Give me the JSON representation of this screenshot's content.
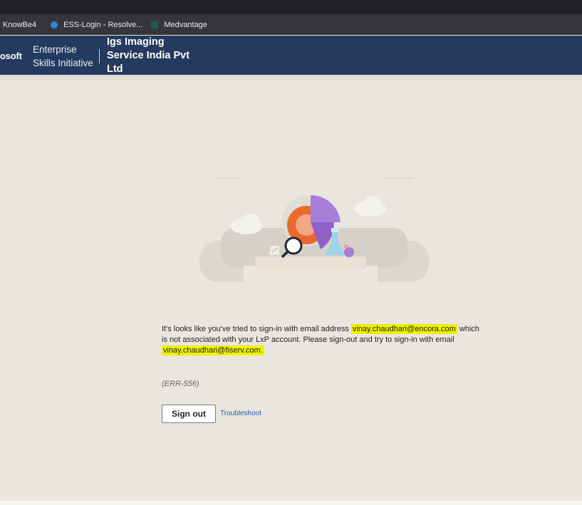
{
  "bookmarks": [
    {
      "label": "KnowBe4",
      "icon": "knowbe4-icon"
    },
    {
      "label": "ESS-Login - Resolve...",
      "icon": "ess-login-icon"
    },
    {
      "label": "Medvantage",
      "icon": "medvantage-icon"
    }
  ],
  "header": {
    "brand": "osoft",
    "app_name_line1": "Enterprise",
    "app_name_line2": "Skills Initiative",
    "org_name_line1": "Igs Imaging",
    "org_name_line2": "Service India Pvt",
    "org_name_line3": "Ltd"
  },
  "message": {
    "part1": "It's looks like you've tried to sign-in with email address ",
    "email_used": "vinay.chaudhari@encora.com",
    "part2": " which is not associated with your LxP account. Please sign-out and try to sign-in with email ",
    "email_expected": "vinay.chaudhari@fiserv.com."
  },
  "error_code": "(ERR-556)",
  "actions": {
    "sign_out_label": "Sign out",
    "troubleshoot_label": "Troubleshoot"
  },
  "colors": {
    "header_bg": "#243a5e",
    "page_bg": "#e9e6e0",
    "highlight": "#f0f000",
    "link": "#2c5aa0"
  }
}
